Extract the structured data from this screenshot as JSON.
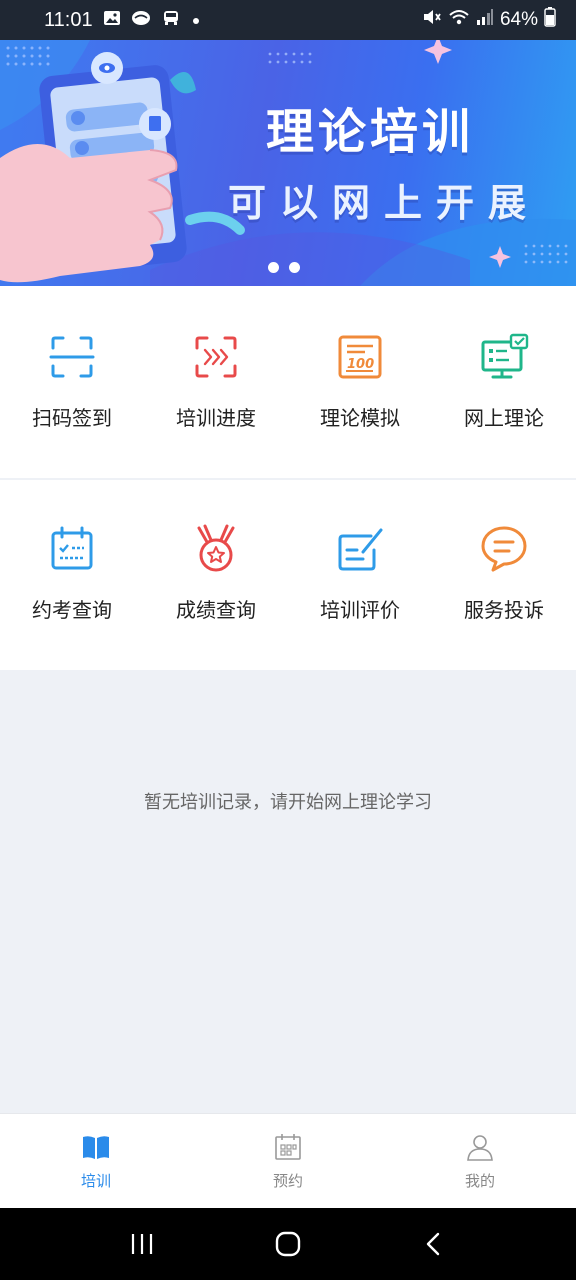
{
  "status_bar": {
    "time": "11:01",
    "battery": "64%",
    "left_icons": [
      "gallery-icon",
      "chat-icon",
      "car-icon",
      "dot-icon"
    ],
    "right_icons": [
      "mute-icon",
      "wifi-icon",
      "signal-icon",
      "battery-icon"
    ]
  },
  "banner": {
    "title": "理论培训",
    "subtitle": "可以网上开展",
    "slide_count": 2,
    "active_slide": 1
  },
  "features_row1": [
    {
      "label": "扫码签到",
      "icon": "scan-icon",
      "color": "#2e9be8"
    },
    {
      "label": "培训进度",
      "icon": "progress-icon",
      "color": "#e84a4a"
    },
    {
      "label": "理论模拟",
      "icon": "exam-paper-icon",
      "color": "#f08a3a"
    },
    {
      "label": "网上理论",
      "icon": "monitor-icon",
      "color": "#1fb68a"
    }
  ],
  "features_row2": [
    {
      "label": "约考查询",
      "icon": "calendar-icon",
      "color": "#2e9be8"
    },
    {
      "label": "成绩查询",
      "icon": "medal-icon",
      "color": "#e84a4a"
    },
    {
      "label": "培训评价",
      "icon": "edit-icon",
      "color": "#2e9be8"
    },
    {
      "label": "服务投诉",
      "icon": "message-icon",
      "color": "#f08a3a"
    }
  ],
  "empty_state": {
    "text": "暂无培训记录，请开始网上理论学习"
  },
  "tabbar": {
    "tabs": [
      {
        "label": "培训",
        "icon": "book-icon",
        "active": true
      },
      {
        "label": "预约",
        "icon": "appointment-icon",
        "active": false
      },
      {
        "label": "我的",
        "icon": "user-icon",
        "active": false
      }
    ],
    "active_color": "#2a8bea",
    "inactive_color": "#888888"
  },
  "nav_bar": {
    "buttons": [
      "recents-icon",
      "home-icon",
      "back-icon"
    ]
  }
}
